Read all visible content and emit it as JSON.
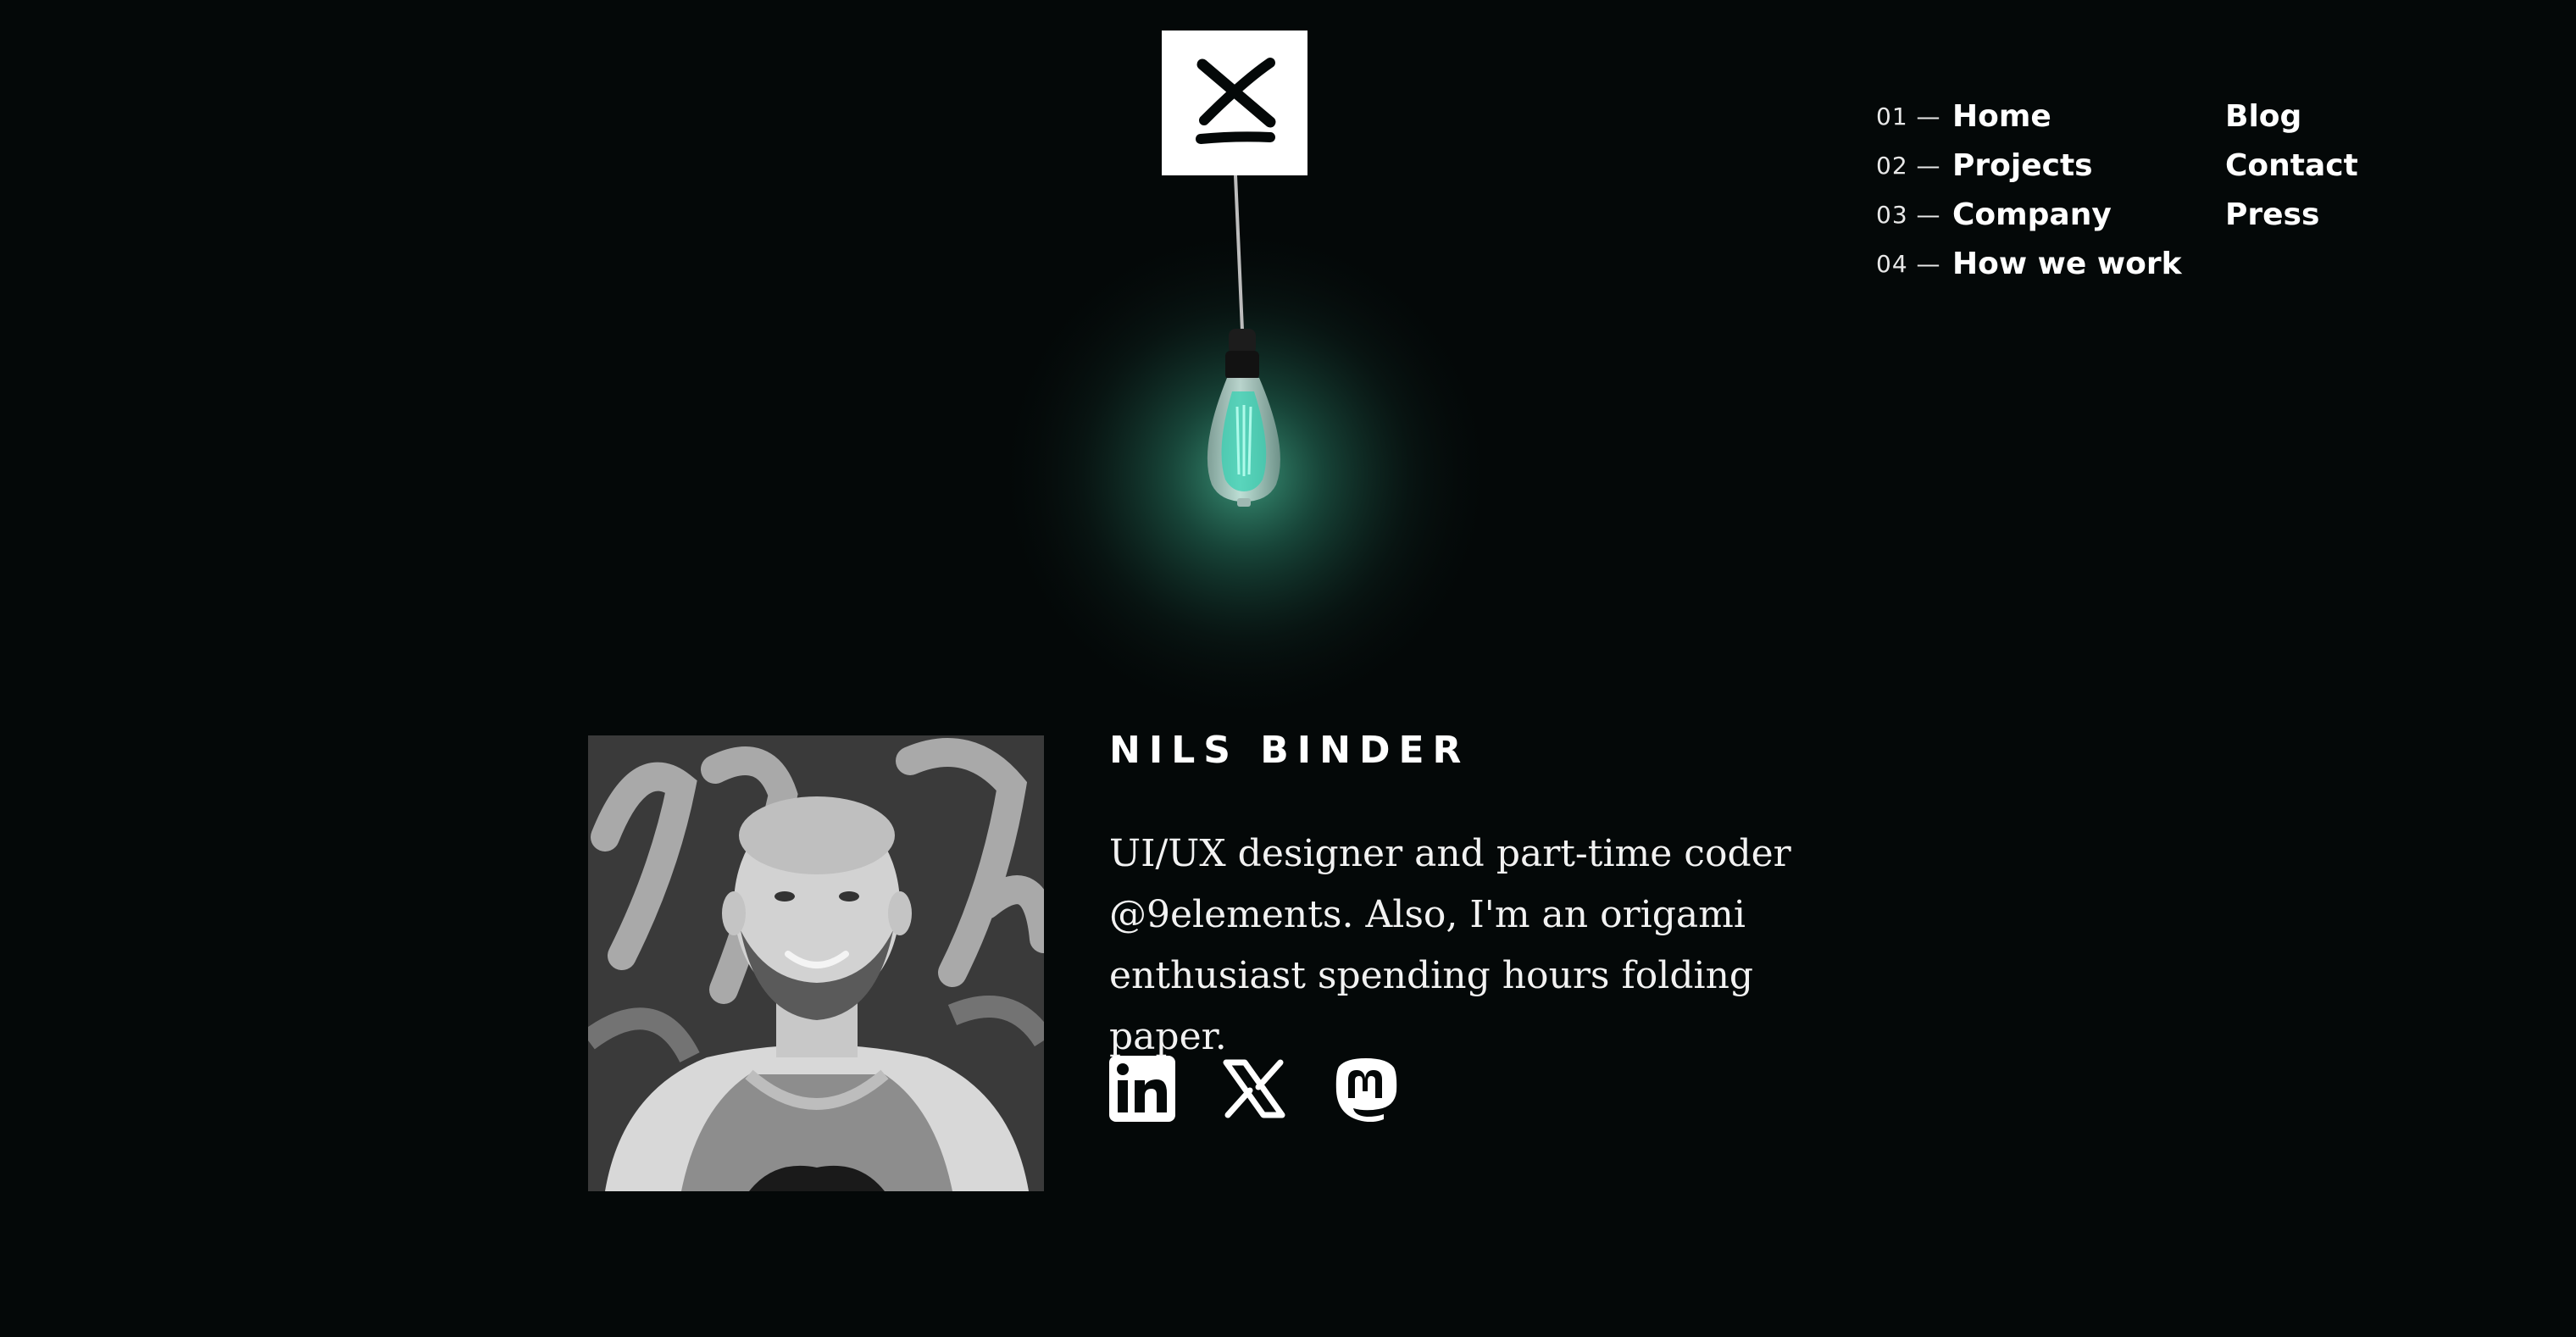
{
  "logo": {
    "icon": "9elements-logo-icon",
    "background": "#ffffff",
    "foreground": "#040808"
  },
  "lamp": {
    "icon": "light-bulb-icon",
    "glow_color": "#2f8f74"
  },
  "nav": {
    "main_items": [
      {
        "number": "01 —",
        "label": "Home"
      },
      {
        "number": "02 —",
        "label": "Projects"
      },
      {
        "number": "03 —",
        "label": "Company"
      },
      {
        "number": "04 —",
        "label": "How we work"
      }
    ],
    "secondary_items": [
      {
        "label": "Blog"
      },
      {
        "label": "Contact"
      },
      {
        "label": "Press"
      }
    ]
  },
  "profile": {
    "name": "NILS BINDER",
    "bio": "UI/UX designer and part-time coder @9elements. Also, I'm an origami enthusiast spending hours folding paper.",
    "photo_icon": "portrait-photo",
    "socials": [
      {
        "name": "linkedin-icon"
      },
      {
        "name": "x-icon"
      },
      {
        "name": "mastodon-icon"
      }
    ]
  },
  "colors": {
    "background": "#040808",
    "text": "#ffffff",
    "accent_glow": "#2f8f74"
  }
}
